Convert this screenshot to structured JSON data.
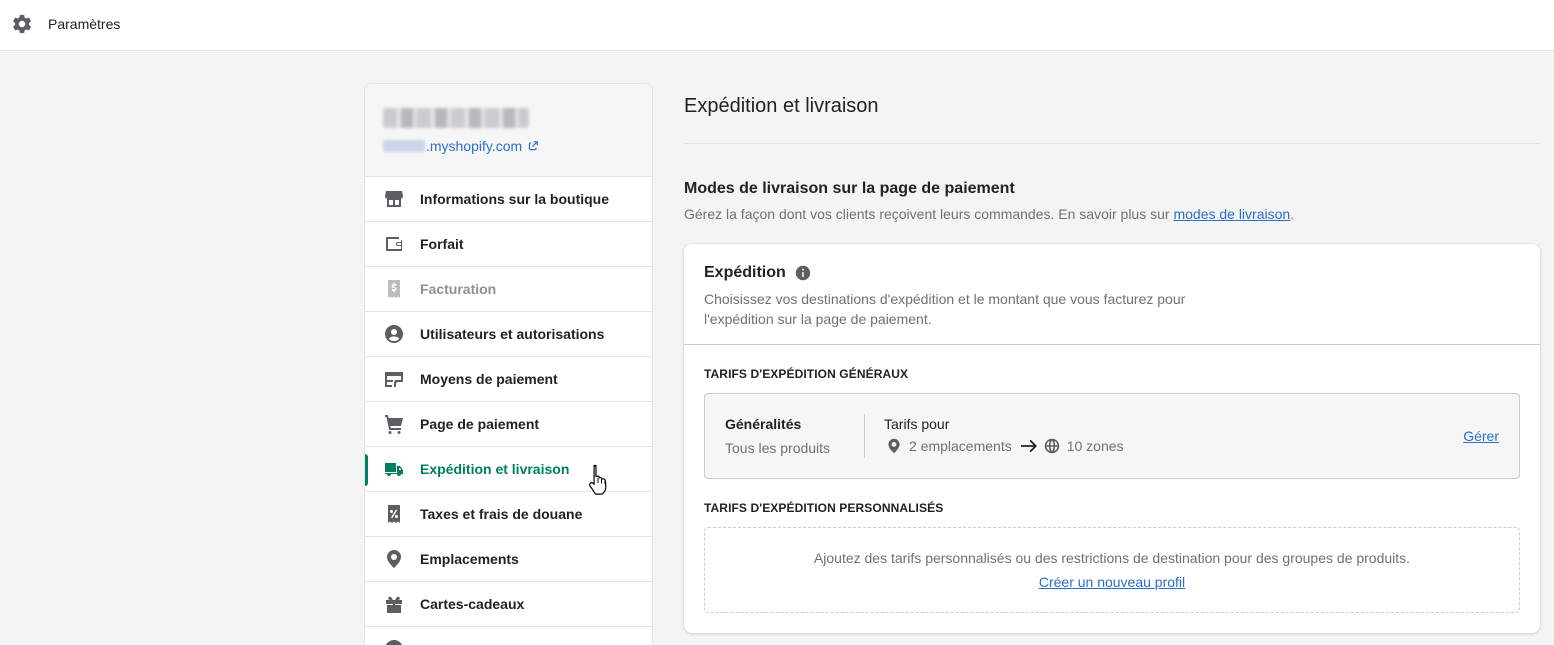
{
  "topbar": {
    "title": "Paramètres",
    "icon": "gear-icon"
  },
  "sidebar": {
    "store_url_suffix": ".myshopify.com",
    "items": [
      {
        "label": "Informations sur la boutique",
        "icon": "store-icon",
        "state": "normal"
      },
      {
        "label": "Forfait",
        "icon": "wallet-icon",
        "state": "normal"
      },
      {
        "label": "Facturation",
        "icon": "receipt-dollar-icon",
        "state": "disabled"
      },
      {
        "label": "Utilisateurs et autorisations",
        "icon": "user-circle-icon",
        "state": "normal"
      },
      {
        "label": "Moyens de paiement",
        "icon": "payment-card-icon",
        "state": "normal"
      },
      {
        "label": "Page de paiement",
        "icon": "cart-icon",
        "state": "normal"
      },
      {
        "label": "Expédition et livraison",
        "icon": "truck-icon",
        "state": "active"
      },
      {
        "label": "Taxes et frais de douane",
        "icon": "receipt-percent-icon",
        "state": "normal"
      },
      {
        "label": "Emplacements",
        "icon": "location-pin-icon",
        "state": "normal"
      },
      {
        "label": "Cartes-cadeaux",
        "icon": "gift-icon",
        "state": "normal"
      }
    ]
  },
  "main": {
    "title": "Expédition et livraison",
    "section": {
      "title": "Modes de livraison sur la page de paiement",
      "desc_prefix": "Gérez la façon dont vos clients reçoivent leurs commandes. En savoir plus sur ",
      "desc_link": "modes de livraison",
      "desc_suffix": "."
    },
    "card": {
      "title": "Expédition",
      "desc": "Choisissez vos destinations d'expédition et le montant que vous facturez pour l'expédition sur la page de paiement.",
      "general": {
        "heading": "TARIFS D'EXPÉDITION GÉNÉRAUX",
        "name": "Généralités",
        "scope": "Tous les produits",
        "rates_label": "Tarifs pour",
        "locations": "2 emplacements",
        "zones": "10 zones",
        "manage": "Gérer"
      },
      "custom": {
        "heading": "TARIFS D'EXPÉDITION PERSONNALISÉS",
        "text": "Ajoutez des tarifs personnalisés ou des restrictions de destination pour des groupes de produits.",
        "link": "Créer un nouveau profil"
      }
    }
  },
  "colors": {
    "accent": "#008060",
    "link": "#2c6ecb",
    "muted": "#6d7175",
    "border": "#e1e3e5"
  }
}
